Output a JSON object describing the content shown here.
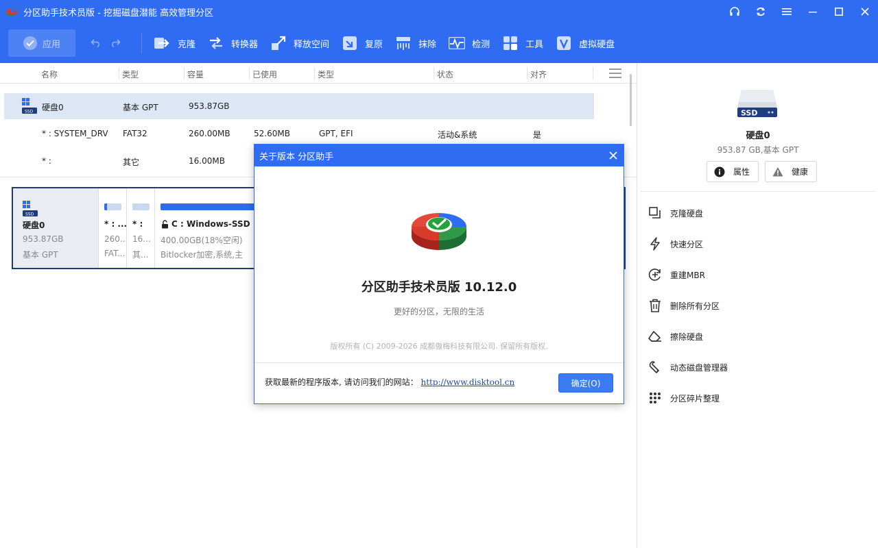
{
  "window": {
    "title": "分区助手技术员版 - 挖掘磁盘潜能 高效管理分区",
    "colors": {
      "primary": "#2f6cf2",
      "selected_row": "#dde6f5",
      "disk_border": "#1a3a7a"
    }
  },
  "toolbar": {
    "apply_label": "应用",
    "tools": [
      {
        "label": "克隆",
        "icon": "clone-icon"
      },
      {
        "label": "转换器",
        "icon": "converter-icon"
      },
      {
        "label": "释放空间",
        "icon": "free-space-icon"
      },
      {
        "label": "复原",
        "icon": "restore-icon"
      },
      {
        "label": "抹除",
        "icon": "wipe-icon"
      },
      {
        "label": "检测",
        "icon": "check-icon"
      },
      {
        "label": "工具",
        "icon": "tools-icon"
      },
      {
        "label": "虚拟硬盘",
        "icon": "virtual-disk-icon"
      }
    ]
  },
  "table": {
    "headers": [
      "名称",
      "类型",
      "容量",
      "已使用",
      "类型",
      "状态",
      "对齐"
    ],
    "disk_row": {
      "name": "硬盘0",
      "type": "基本 GPT",
      "capacity": "953.87GB"
    },
    "rows": [
      {
        "name": "* : SYSTEM_DRV",
        "type": "FAT32",
        "capacity": "260.00MB",
        "used": "52.60MB",
        "ptype": "GPT, EFI",
        "status": "活动&系统",
        "align": "是"
      },
      {
        "name": "* :",
        "type": "其它",
        "capacity": "16.00MB",
        "used": "",
        "ptype": "",
        "status": "",
        "align": ""
      }
    ]
  },
  "diskmap": {
    "disk": {
      "name": "硬盘0",
      "size": "953.87GB",
      "type": "基本 GPT"
    },
    "partitions": [
      {
        "name": "* : ...",
        "size": "260...",
        "fs": "FAT..."
      },
      {
        "name": "* :",
        "size": "16...",
        "fs": "其..."
      },
      {
        "name": "C : Windows-SSD",
        "size": "400.00GB(18%空闲)",
        "fs": "Bitlocker加密,系统,主"
      }
    ]
  },
  "right_panel": {
    "disk_badge": "SSD",
    "disk_name": "硬盘0",
    "disk_info": "953.87 GB,基本 GPT",
    "properties_label": "属性",
    "health_label": "健康",
    "operations": [
      {
        "label": "克隆硬盘",
        "icon": "clone-disk-icon"
      },
      {
        "label": "快速分区",
        "icon": "lightning-icon"
      },
      {
        "label": "重建MBR",
        "icon": "rebuild-mbr-icon"
      },
      {
        "label": "删除所有分区",
        "icon": "trash-icon"
      },
      {
        "label": "擦除硬盘",
        "icon": "eraser-icon"
      },
      {
        "label": "动态磁盘管理器",
        "icon": "wrench-icon"
      },
      {
        "label": "分区碎片整理",
        "icon": "defrag-icon"
      }
    ]
  },
  "dialog": {
    "title": "关于版本 分区助手",
    "product": "分区助手技术员版 10.12.0",
    "slogan": "更好的分区，无限的生活",
    "copyright": "版权所有 (C) 2009-2026 成都傲梅科技有限公司. 保留所有版权.",
    "visit_text": "获取最新的程序版本, 请访问我们的网站：",
    "link": "http://www.disktool.cn",
    "ok_label": "确定(O)"
  }
}
